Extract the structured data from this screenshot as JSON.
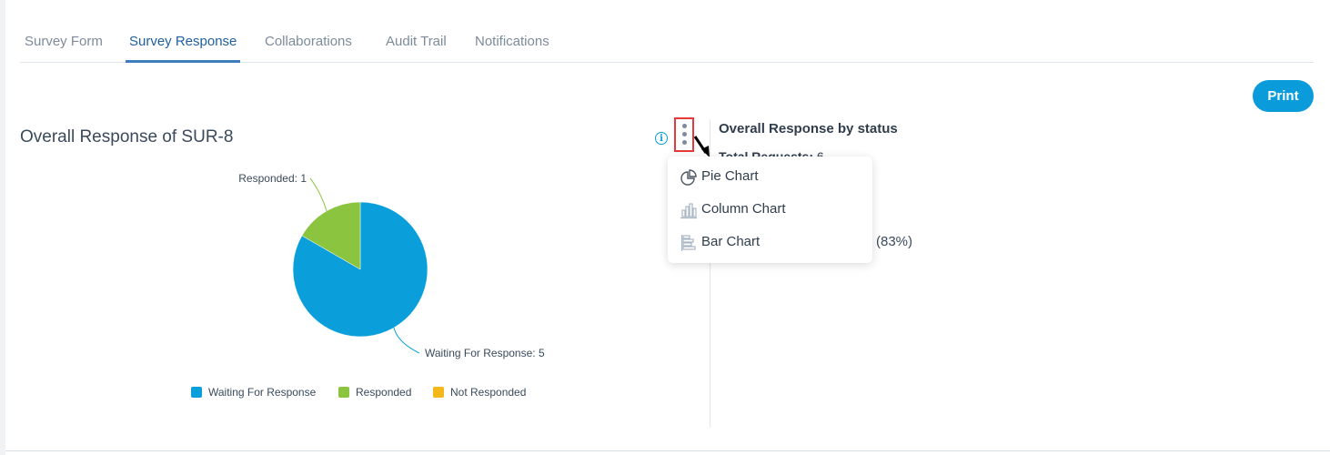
{
  "tabs": [
    {
      "label": "Survey Form",
      "active": false
    },
    {
      "label": "Survey Response",
      "active": true
    },
    {
      "label": "Collaborations",
      "active": false
    },
    {
      "label": "Audit Trail",
      "active": false
    },
    {
      "label": "Notifications",
      "active": false
    }
  ],
  "print_label": "Print",
  "chart_title": "Overall Response of SUR-8",
  "info_icon": "i",
  "right_panel": {
    "title": "Overall Response by status",
    "total_label": "Total Requests:",
    "total_value": "6",
    "percent_text": "(83%)"
  },
  "chart_menu": {
    "items": [
      {
        "label": "Pie Chart",
        "icon": "pie-chart-icon"
      },
      {
        "label": "Column Chart",
        "icon": "column-chart-icon"
      },
      {
        "label": "Bar Chart",
        "icon": "bar-chart-icon"
      }
    ]
  },
  "chart_data": {
    "type": "pie",
    "title": "Overall Response of SUR-8",
    "categories": [
      "Waiting For Response",
      "Responded",
      "Not Responded"
    ],
    "values": [
      5,
      1,
      0
    ],
    "colors": [
      "#0a9fdb",
      "#8bc43f",
      "#f5b81b"
    ],
    "data_labels": [
      "Waiting For Response: 5",
      "Responded: 1"
    ],
    "legend": {
      "position": "bottom",
      "entries": [
        "Waiting For Response",
        "Responded",
        "Not Responded"
      ]
    }
  }
}
